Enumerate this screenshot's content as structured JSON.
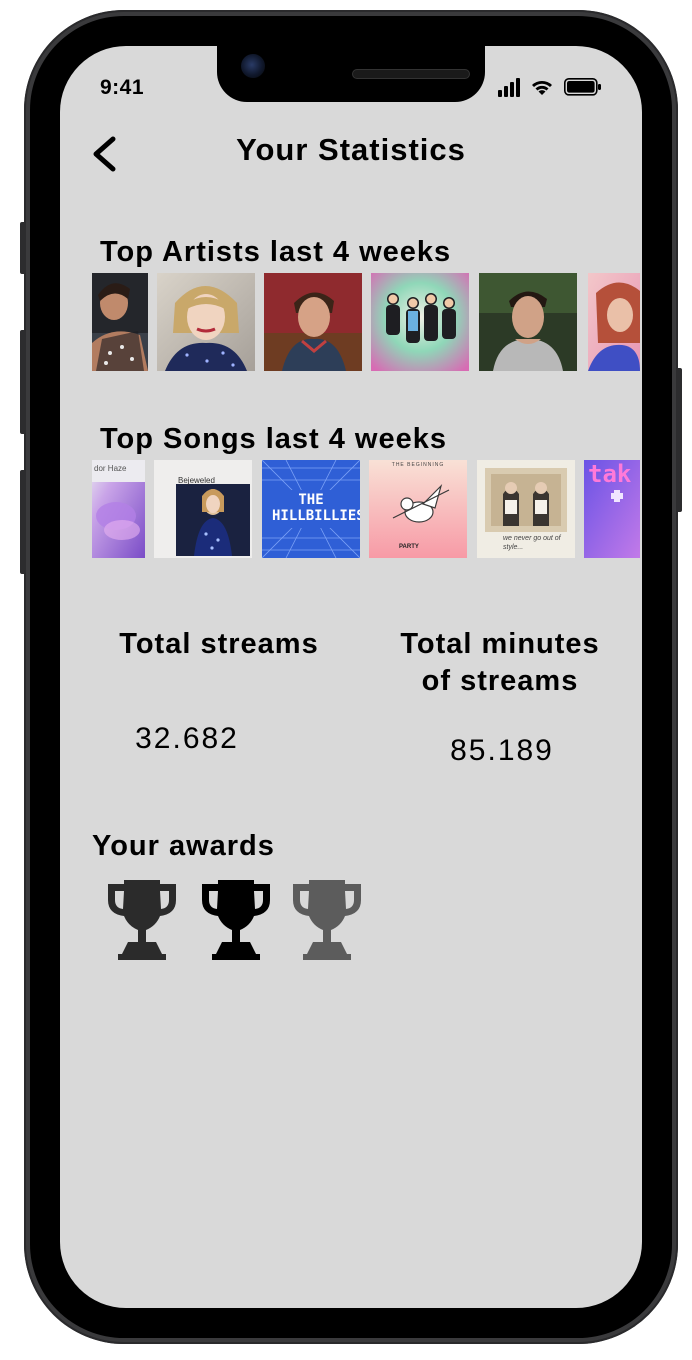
{
  "status_bar": {
    "time": "9:41"
  },
  "header": {
    "title": "Your Statistics",
    "back_icon": "chevron-left-icon"
  },
  "top_artists": {
    "title": "Top Artists last 4 weeks",
    "items": [
      {
        "name": "artist-1"
      },
      {
        "name": "artist-2"
      },
      {
        "name": "artist-3"
      },
      {
        "name": "artist-4"
      },
      {
        "name": "artist-5"
      },
      {
        "name": "artist-6"
      }
    ]
  },
  "top_songs": {
    "title": "Top Songs last 4 weeks",
    "items": [
      {
        "cover_text": "dor Haze"
      },
      {
        "cover_text": "Bejeweled"
      },
      {
        "cover_text": "THE HILLBILLIES"
      },
      {
        "cover_text": "THE BEGINNING",
        "cover_subtext": "PARTY"
      },
      {
        "cover_text": "we never go out of style..."
      },
      {
        "cover_text": "tak"
      }
    ]
  },
  "stats": {
    "total_streams_label": "Total streams",
    "total_streams_value": "32.682",
    "total_minutes_label_line1": "Total minutes",
    "total_minutes_label_line2": "of streams",
    "total_minutes_value": "85.189"
  },
  "awards": {
    "title": "Your awards",
    "items": [
      {
        "icon": "trophy-icon",
        "color": "#2b2b2b"
      },
      {
        "icon": "trophy-icon",
        "color": "#000000"
      },
      {
        "icon": "trophy-icon",
        "color": "#5c5c5c"
      }
    ]
  },
  "colors": {
    "screen_bg": "#d9d9d9",
    "text": "#000000"
  }
}
